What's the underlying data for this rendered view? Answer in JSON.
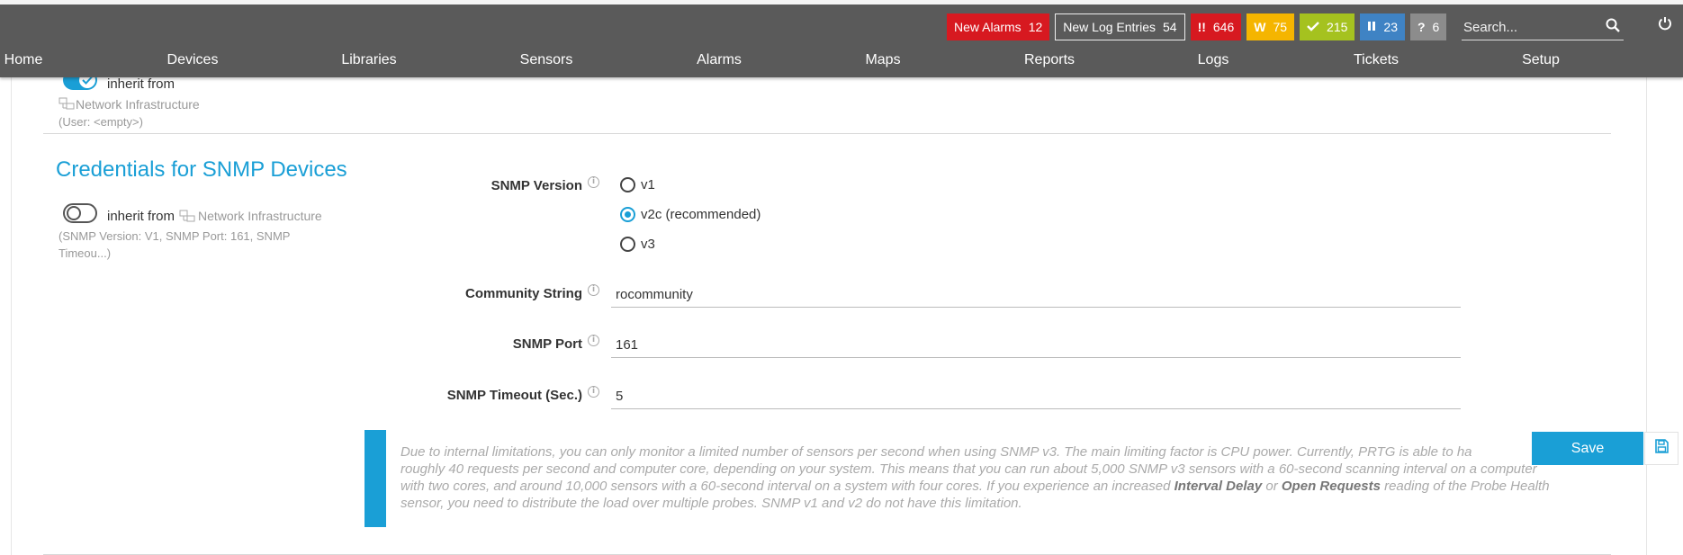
{
  "topbar": {
    "badges": {
      "new_alarms": {
        "label": "New Alarms",
        "count": "12"
      },
      "new_log_entries": {
        "label": "New Log Entries",
        "count": "54"
      },
      "down": {
        "glyph": "!!",
        "count": "646"
      },
      "warning": {
        "glyph": "W",
        "count": "75"
      },
      "up": {
        "count": "215"
      },
      "paused": {
        "count": "23"
      },
      "unknown": {
        "glyph": "?",
        "count": "6"
      }
    },
    "search": {
      "placeholder": "Search..."
    }
  },
  "nav": {
    "items": [
      "Home",
      "Devices",
      "Libraries",
      "Sensors",
      "Alarms",
      "Maps",
      "Reports",
      "Logs",
      "Tickets",
      "Setup"
    ]
  },
  "prev_section": {
    "inherit_label": "inherit from",
    "source": "Network Infrastructure",
    "summary": "(User: <empty>)"
  },
  "snmp": {
    "title": "Credentials for SNMP Devices",
    "inherit_label": "inherit from",
    "source": "Network Infrastructure",
    "summary_line1": "(SNMP Version: V1, SNMP Port: 161, SNMP",
    "summary_line2": "Timeou...)",
    "version_label": "SNMP Version",
    "versions": [
      "v1",
      "v2c (recommended)",
      "v3"
    ],
    "selected_version": "v2c (recommended)",
    "community_label": "Community String",
    "community_value": "rocommunity",
    "port_label": "SNMP Port",
    "port_value": "161",
    "timeout_label": "SNMP Timeout (Sec.)",
    "timeout_value": "5"
  },
  "note": {
    "part1": "Due to internal limitations, you can only monitor a limited number of sensors per second when using SNMP v3. The main limiting factor is CPU power. Currently, PRTG is able to ha",
    "part2": "roughly 40 requests per second and computer core, depending on your system. This means that you can run about 5,000 SNMP v3 sensors with a 60-second scanning interval on a computer with two cores, and around 10,000 sensors with a 60-second interval on a system with four cores. If you experience an increased ",
    "bold1": "Interval Delay",
    "or": " or ",
    "bold2": "Open Requests",
    "part3": " reading of the Probe Health sensor, you need to distribute the load over multiple probes. SNMP v1 and v2 do not have this limitation."
  },
  "actions": {
    "save_label": "Save"
  },
  "colors": {
    "accent": "#1a9fd6",
    "topbar": "#5a5a5a",
    "alarm": "#d71920",
    "warning": "#f5b500",
    "ok": "#a5c21f",
    "paused": "#3f83c4",
    "unknown": "#8c8c8c"
  }
}
